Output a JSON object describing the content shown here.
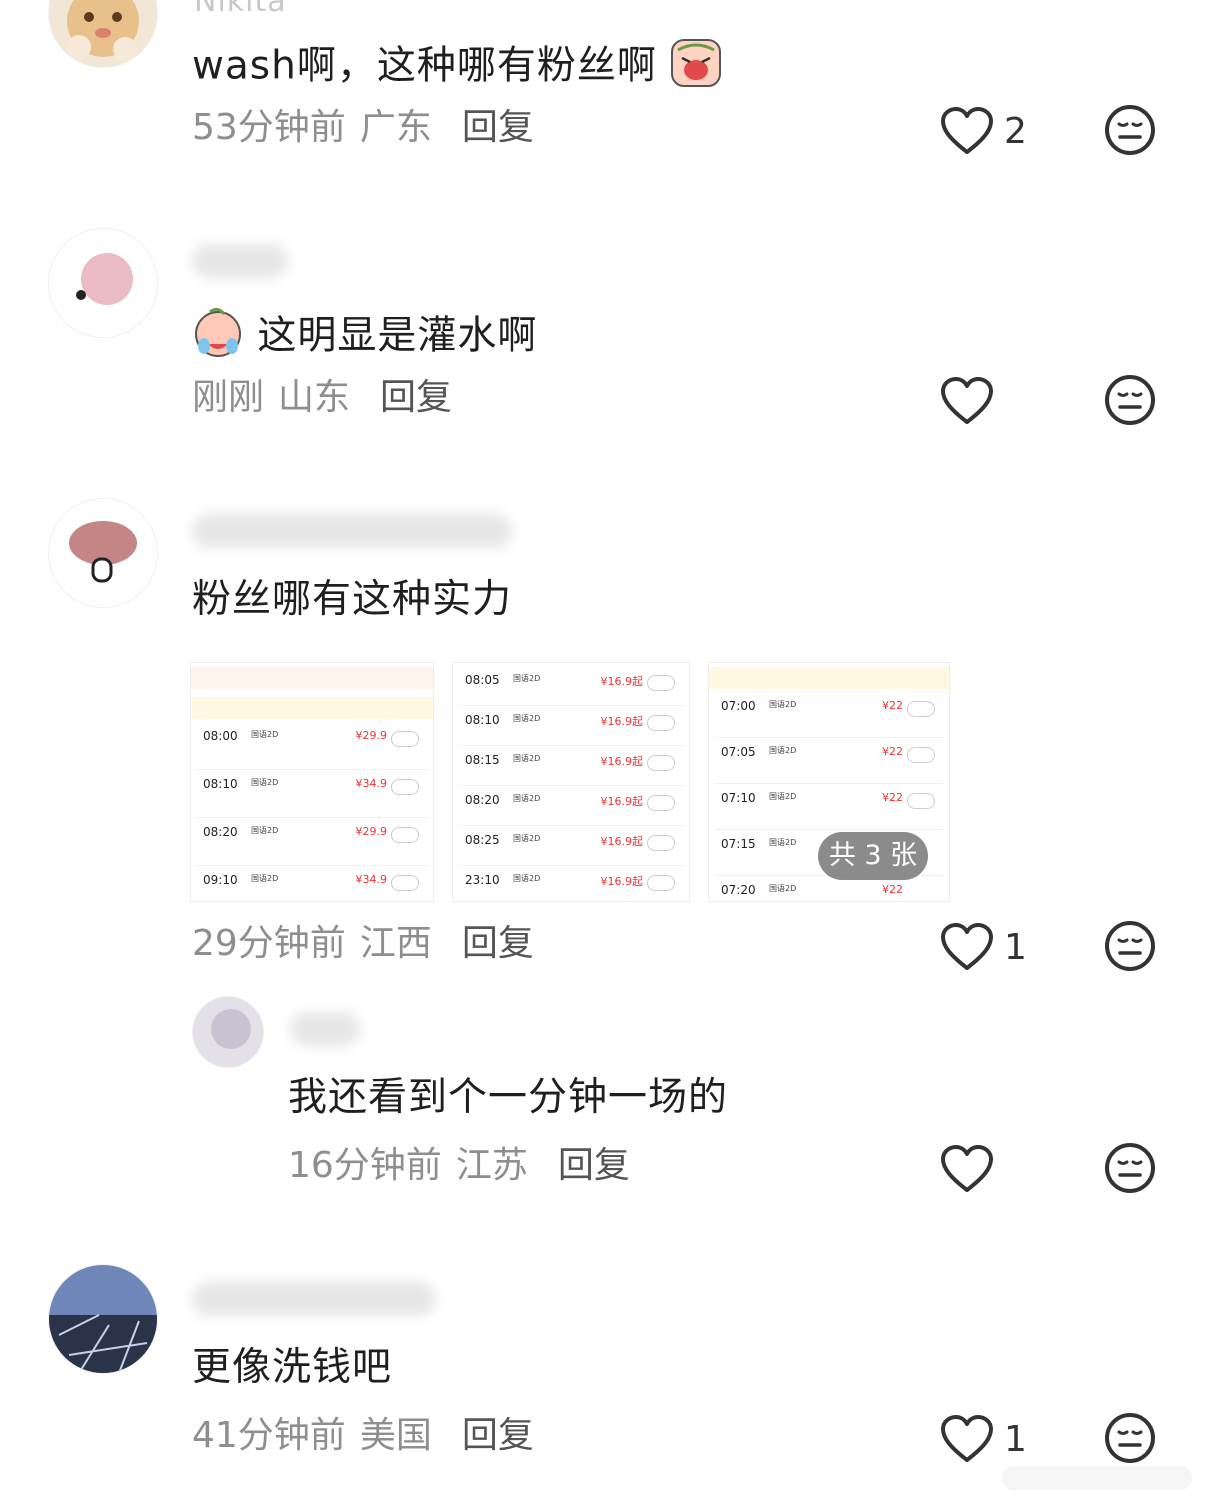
{
  "comments": [
    {
      "name": "Nikita",
      "text": "wash啊，这种哪有粉丝啊",
      "time": "53分钟前",
      "location": "广东",
      "reply": "回复",
      "likes": "2"
    },
    {
      "text": "这明显是灌水啊",
      "time": "刚刚",
      "location": "山东",
      "reply": "回复",
      "likes": ""
    },
    {
      "text": "粉丝哪有这种实力",
      "time": "29分钟前",
      "location": "江西",
      "reply": "回复",
      "likes": "1",
      "image_count_badge": "共 3 张"
    },
    {
      "text": "我还看到个一分钟一场的",
      "time": "16分钟前",
      "location": "江苏",
      "reply": "回复",
      "likes": ""
    },
    {
      "text": "更像洗钱吧",
      "time": "41分钟前",
      "location": "美国",
      "reply": "回复",
      "likes": "1"
    }
  ],
  "thumb1": {
    "rows": [
      {
        "time": "08:00",
        "type": "国语2D",
        "price": "¥29.9"
      },
      {
        "time": "08:10",
        "type": "国语2D",
        "price": "¥34.9"
      },
      {
        "time": "08:20",
        "type": "国语2D",
        "price": "¥29.9"
      },
      {
        "time": "09:10",
        "type": "国语2D",
        "price": "¥34.9"
      }
    ]
  },
  "thumb2": {
    "rows": [
      {
        "time": "08:05",
        "type": "国语2D",
        "price": "¥16.9起"
      },
      {
        "time": "08:10",
        "type": "国语2D",
        "price": "¥16.9起"
      },
      {
        "time": "08:15",
        "type": "国语2D",
        "price": "¥16.9起"
      },
      {
        "time": "08:20",
        "type": "国语2D",
        "price": "¥16.9起"
      },
      {
        "time": "08:25",
        "type": "国语2D",
        "price": "¥16.9起"
      },
      {
        "time": "23:10",
        "type": "国语2D",
        "price": "¥16.9起"
      }
    ]
  },
  "thumb3": {
    "rows": [
      {
        "time": "07:00",
        "type": "国语2D",
        "price": "¥22"
      },
      {
        "time": "07:05",
        "type": "国语2D",
        "price": "¥22"
      },
      {
        "time": "07:10",
        "type": "国语2D",
        "price": "¥22"
      },
      {
        "time": "07:15",
        "type": "国语2D",
        "price": ""
      },
      {
        "time": "07:20",
        "type": "国语2D",
        "price": "¥22"
      }
    ]
  },
  "colors": {
    "meta": "#8e8e8e",
    "price": "#e33333",
    "badge_bg": "#6e6e6e"
  },
  "icons": {
    "like": "heart-outline-icon",
    "dislike": "neutral-face-icon"
  }
}
